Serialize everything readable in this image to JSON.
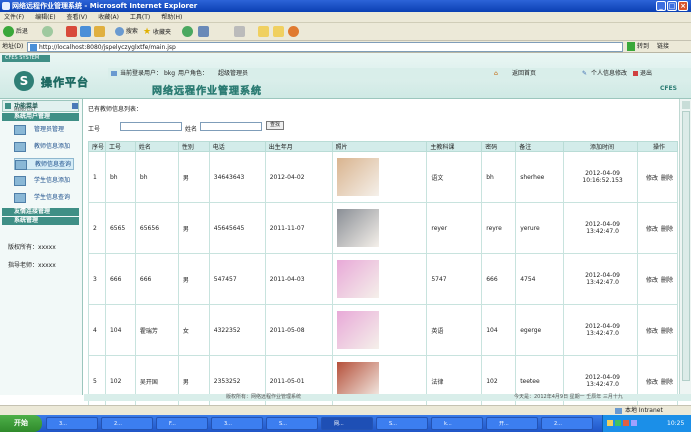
{
  "window": {
    "title": "网络远程作业管理系统 - Microsoft Internet Explorer"
  },
  "menu": [
    "文件(F)",
    "编辑(E)",
    "查看(V)",
    "收藏(A)",
    "工具(T)",
    "帮助(H)"
  ],
  "toolbar": {
    "back": "后退",
    "search": "搜索",
    "favorites": "收藏夹"
  },
  "address": {
    "label": "地址(D)",
    "url": "http://localhost:8080/jspelyczyglxtfe/main.jsp",
    "go": "转到",
    "links": "链接"
  },
  "app": {
    "tab": "CFES SYSTEM",
    "logo_char": "S",
    "logo_text": "操作平台",
    "current_user_label": "当前登录用户：",
    "current_user": "bkg",
    "role_label": "用户角色：",
    "role": "超级管理员",
    "home": "返回首页",
    "profile": "个人信息修改",
    "logout": "退出",
    "system_title": "网络远程作业管理系统",
    "brand": "CFES"
  },
  "sidebar": {
    "menu_title": "功能菜单",
    "menu_sub": "MENU LIST",
    "section1": "系统用户管理",
    "items": [
      "管理员管理",
      "教师信息添加",
      "教师信息查询",
      "学生信息添加",
      "学生信息查询"
    ],
    "section2": "友情连接管理",
    "section3": "系统管理",
    "copyright_label": "版权所有：",
    "copyright": "xxxxx",
    "instructor_label": "指导老师：",
    "instructor": "xxxxx"
  },
  "main": {
    "list_title": "已有教师信息列表：",
    "search_id_label": "工号",
    "search_name_label": "姓名",
    "search_button": "查找",
    "headers": [
      "序号",
      "工号",
      "姓名",
      "性别",
      "电话",
      "出生年月",
      "照片",
      "主教科课",
      "密码",
      "备注",
      "添加时间",
      "操作"
    ],
    "rows": [
      {
        "no": "1",
        "id": "bh",
        "name": "bh",
        "gender": "男",
        "phone": "34643643",
        "birth": "2012-04-02",
        "subject": "语文",
        "pwd": "bh",
        "note": "sherhee",
        "time": "2012-04-09 10:16:52.153",
        "edit": "修改",
        "del": "删除",
        "photo": "#d9b48f"
      },
      {
        "no": "2",
        "id": "6565",
        "name": "65656",
        "gender": "男",
        "phone": "45645645",
        "birth": "2011-11-07",
        "subject": "reyer",
        "pwd": "reyre",
        "note": "yerure",
        "time": "2012-04-09 13:42:47.0",
        "edit": "修改",
        "del": "删除",
        "photo": "#8a8f96"
      },
      {
        "no": "3",
        "id": "666",
        "name": "666",
        "gender": "男",
        "phone": "547457",
        "birth": "2011-04-03",
        "subject": "5747",
        "pwd": "666",
        "note": "4754",
        "time": "2012-04-09 13:42:47.0",
        "edit": "修改",
        "del": "删除",
        "photo": "#e8a9d8"
      },
      {
        "no": "4",
        "id": "104",
        "name": "霍瑞芳",
        "gender": "女",
        "phone": "4322352",
        "birth": "2011-05-08",
        "subject": "英语",
        "pwd": "104",
        "note": "egerge",
        "time": "2012-04-09 13:42:47.0",
        "edit": "修改",
        "del": "删除",
        "photo": "#e8a9d8"
      },
      {
        "no": "5",
        "id": "102",
        "name": "吴开国",
        "gender": "男",
        "phone": "2353252",
        "birth": "2011-05-01",
        "subject": "法律",
        "pwd": "102",
        "note": "teetee",
        "time": "2012-04-09 13:42:47.0",
        "edit": "修改",
        "del": "删除",
        "photo": "#b5503a"
      }
    ]
  },
  "footer": {
    "left": "版权所有：网络远程作业管理系统",
    "right": "今天是：2012年4月9日 星期一 壬辰年 三月十九"
  },
  "status": {
    "zone": "本地 Intranet"
  },
  "taskbar": {
    "start": "开始",
    "tasks": [
      "3...",
      "2...",
      "F...",
      "3...",
      "S...",
      "网...",
      "S...",
      "k...",
      "开...",
      "2..."
    ],
    "clock": "10:25"
  }
}
